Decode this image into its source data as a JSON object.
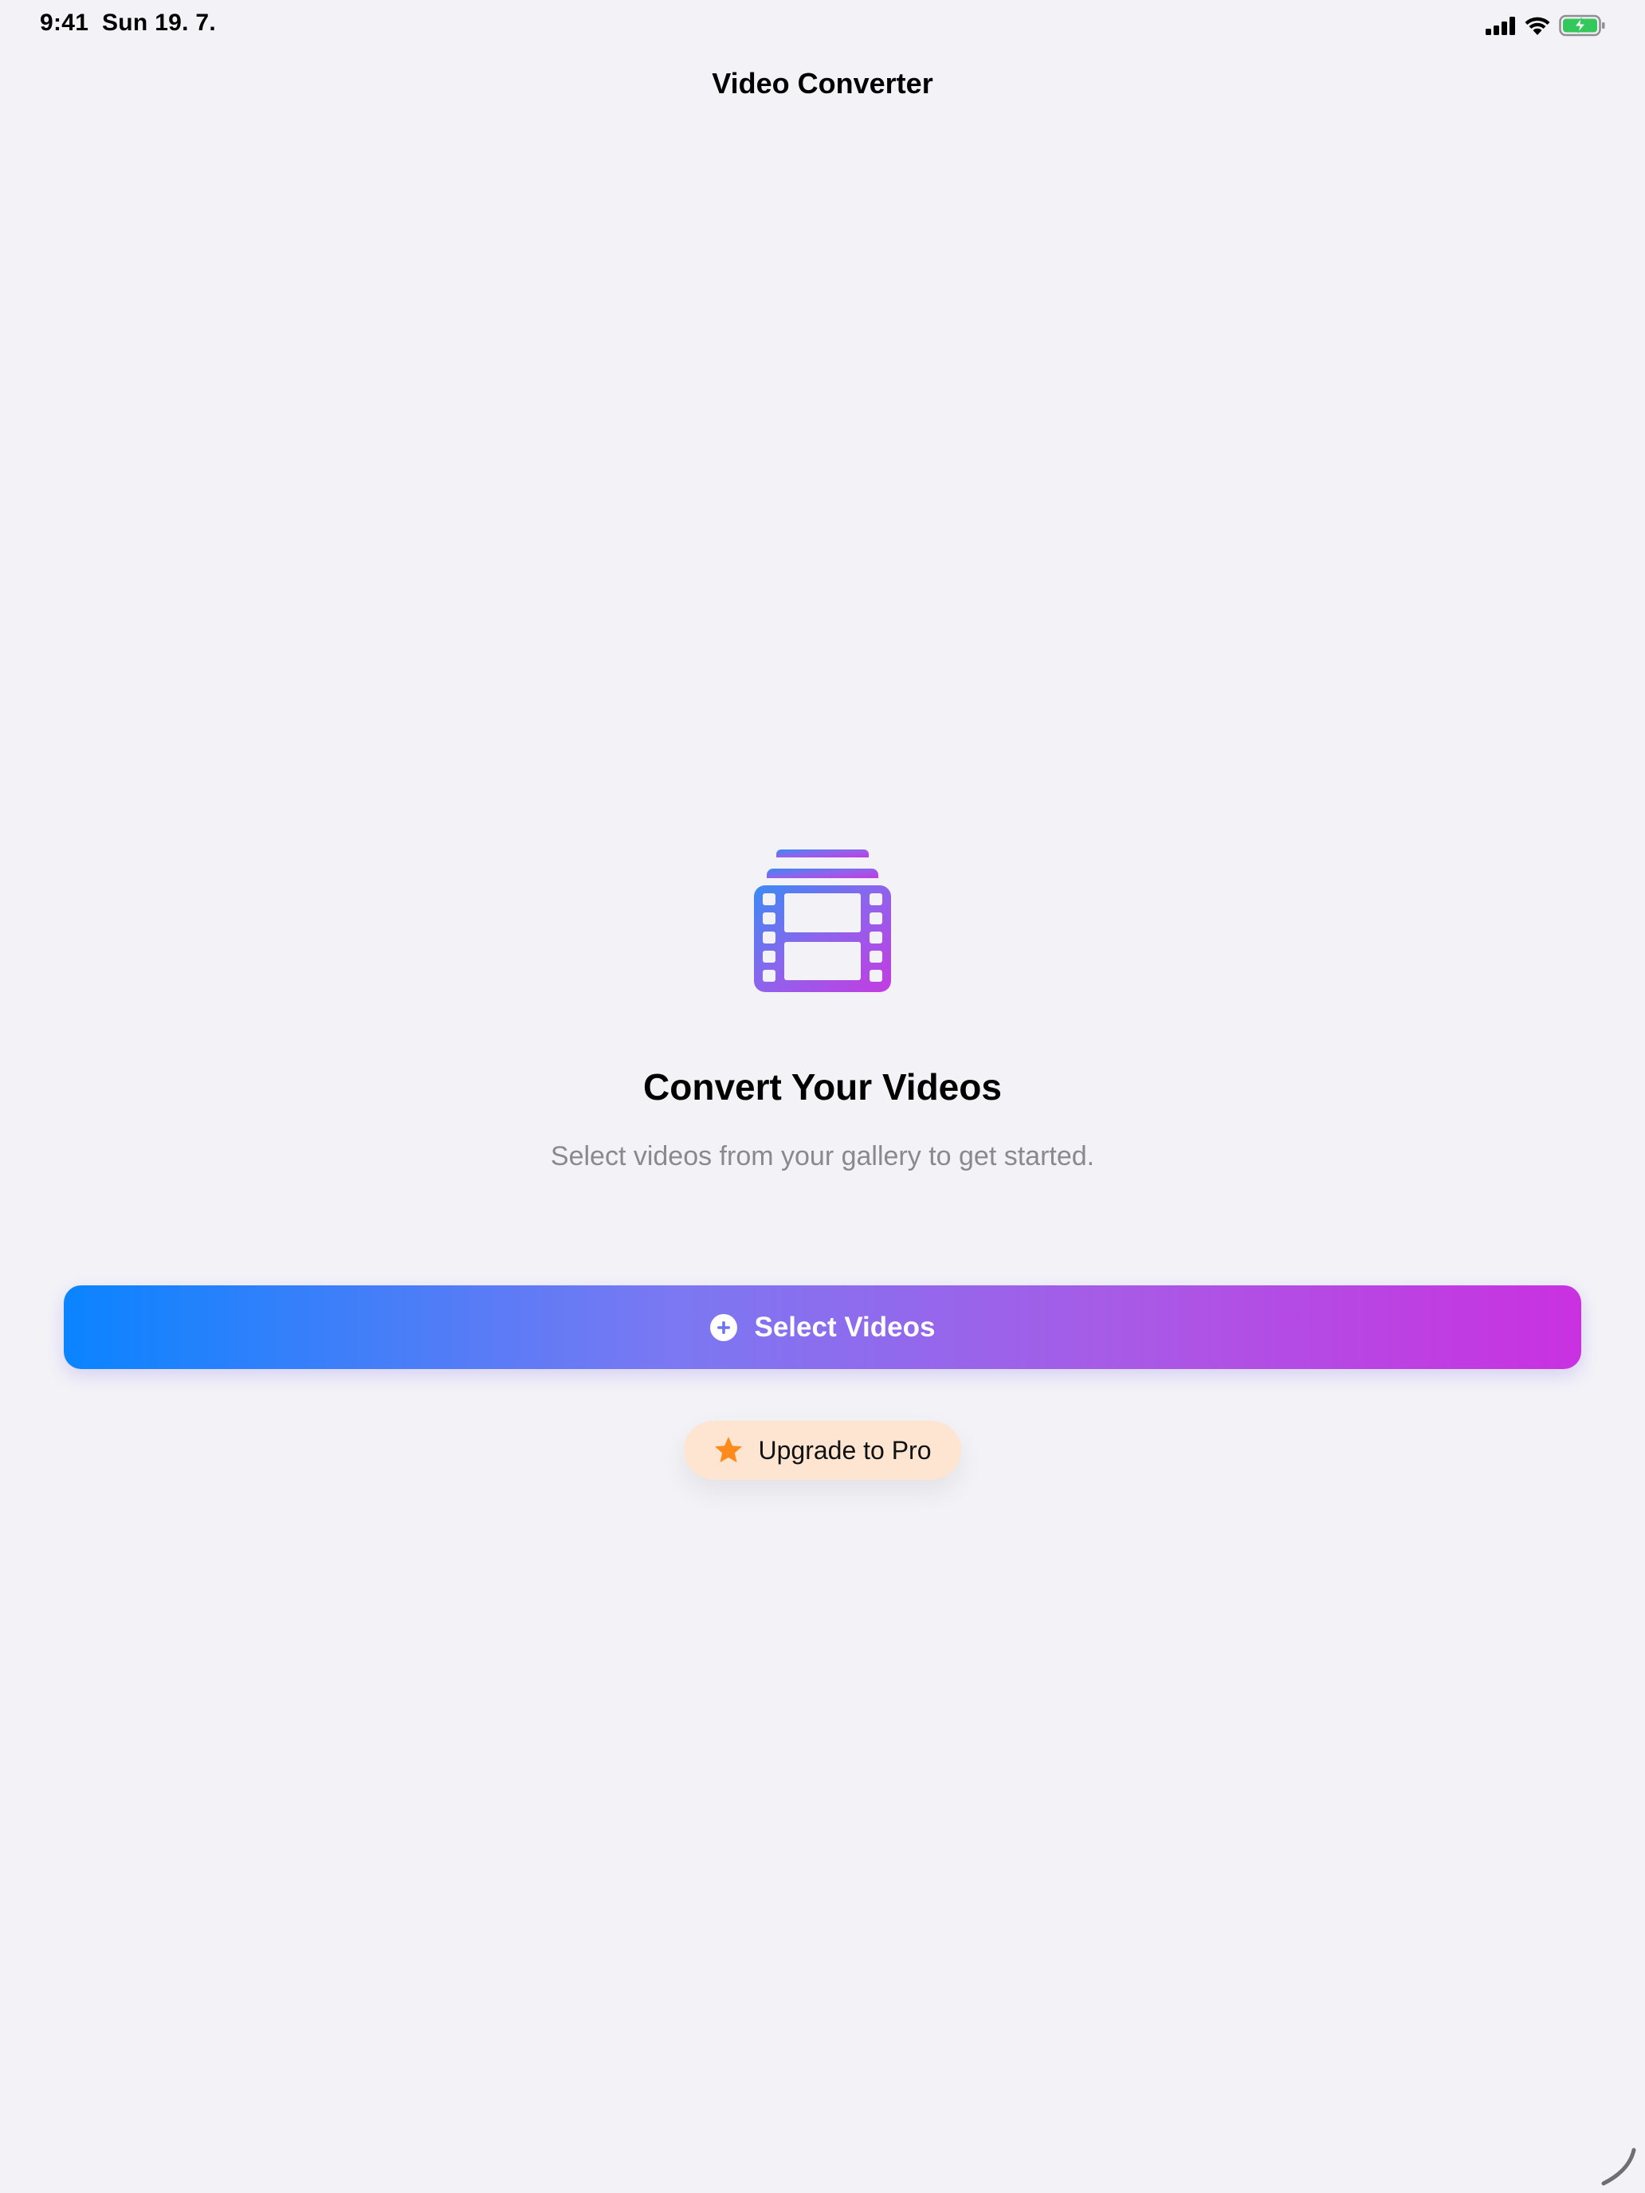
{
  "status_bar": {
    "time": "9:41",
    "date": "Sun 19. 7.",
    "icons": [
      "cellular-signal-icon",
      "wifi-icon",
      "battery-charging-icon"
    ]
  },
  "nav": {
    "title": "Video Converter"
  },
  "empty_state": {
    "icon": "film-stack-icon",
    "title": "Convert Your Videos",
    "subtitle": "Select videos from your gallery to get started."
  },
  "actions": {
    "select": {
      "icon": "plus-circle-icon",
      "label": "Select Videos"
    },
    "upgrade": {
      "icon": "star-icon",
      "label": "Upgrade to Pro"
    }
  },
  "colors": {
    "background": "#f2f2f7",
    "gradient_start": "#0a84ff",
    "gradient_end": "#c931e0",
    "upgrade_bg": "#fde5d2",
    "star": "#ff8a1e",
    "battery": "#34c759",
    "subtitle": "#8a8a8e"
  }
}
